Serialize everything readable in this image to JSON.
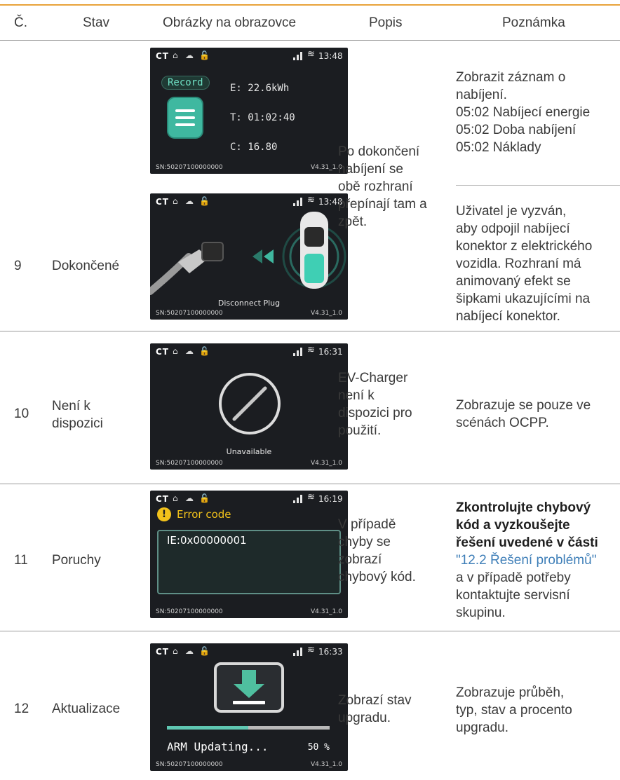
{
  "header": {
    "col_no": "Č.",
    "col_state": "Stav",
    "col_screen": "Obrázky na obrazovce",
    "col_desc": "Popis",
    "col_note": "Poznámka"
  },
  "rows": [
    {
      "no": "9",
      "state": "Dokončené",
      "desc": "Po dokončení\nnabíjení se\nobě rozhraní\npřepínají tam a\nzpět.",
      "note1": "Zobrazit záznam o\nnabíjení.\n05:02 Nabíjecí energie\n05:02 Doba nabíjení\n05:02 Náklady",
      "note2": "Uživatel je vyzván,\naby odpojil nabíjecí\nkonektor z elektrického\nvozidla. Rozhraní má\nanimovaný efekt se\nšipkami ukazujícími na\nnabíjecí konektor."
    },
    {
      "no": "10",
      "state": "Není k\ndispozici",
      "desc": "EV-Charger\nnení k\ndispozici pro\npoužití.",
      "note": "Zobrazuje se pouze ve\nscénách OCPP."
    },
    {
      "no": "11",
      "state": "Poruchy",
      "desc": "V případě\nchyby se\nzobrazí\nchybový kód.",
      "note_bold": "Zkontrolujte chybový\nkód a vyzkoušejte\nřešení uvedené v části",
      "note_link": "\"12.2 Řešení problémů\"",
      "note_rest": "a v případě potřeby\nkontaktujte servisní\nskupinu."
    },
    {
      "no": "12",
      "state": "Aktualizace",
      "desc": "Zobrazí stav\nupgradu.",
      "note": "Zobrazuje průběh,\ntyp, stav a procento\nupgradu."
    }
  ],
  "screens": {
    "brand": "CT",
    "sn": "SN:50207100000000",
    "version": "V4.31_1.0",
    "record": {
      "time": "13:48",
      "badge": "Record",
      "energy": "E: 22.6kWh",
      "duration": "T: 01:02:40",
      "cost": "C: 16.80",
      "accent": "#3fb8a0"
    },
    "disconnect": {
      "time": "13:48",
      "label": "Disconnect Plug"
    },
    "unavailable": {
      "time": "16:31",
      "label": "Unavailable"
    },
    "error": {
      "time": "16:19",
      "title": "Error code",
      "code": "IE:0x00000001",
      "accent": "#f2c21b"
    },
    "update": {
      "time": "16:33",
      "label": "ARM Updating...",
      "percent_text": "50 %",
      "progress": 0.5,
      "accent": "#5fc7b2"
    }
  }
}
